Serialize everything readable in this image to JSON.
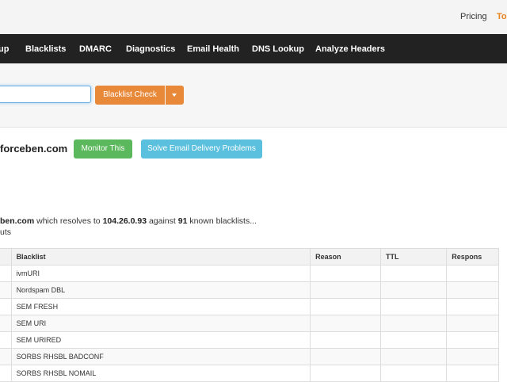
{
  "header": {
    "pricing": "Pricing",
    "tools": "To"
  },
  "nav": [
    "up",
    "Blacklists",
    "DMARC",
    "Diagnostics",
    "Email Health",
    "DNS Lookup",
    "Analyze Headers"
  ],
  "search": {
    "value": "",
    "button": "Blacklist Check"
  },
  "result": {
    "domain": "forceben.com",
    "monitor_button": "Monitor This",
    "solve_button": "Solve Email Delivery Problems",
    "resolve_prefix": "ben.com",
    "resolve_mid1": " which resolves to ",
    "ip": "104.26.0.93",
    "resolve_mid2": " against ",
    "count": "91",
    "resolve_suffix": " known blacklists...",
    "timeouts": "uts"
  },
  "table": {
    "headers": [
      "",
      "Blacklist",
      "Reason",
      "TTL",
      "Respons"
    ],
    "rows": [
      [
        "",
        "ivmURI",
        "",
        "",
        ""
      ],
      [
        "",
        "Nordspam DBL",
        "",
        "",
        ""
      ],
      [
        "",
        "SEM FRESH",
        "",
        "",
        ""
      ],
      [
        "",
        "SEM URI",
        "",
        "",
        ""
      ],
      [
        "",
        "SEM URIRED",
        "",
        "",
        ""
      ],
      [
        "",
        "SORBS RHSBL BADCONF",
        "",
        "",
        ""
      ],
      [
        "",
        "SORBS RHSBL NOMAIL",
        "",
        "",
        ""
      ]
    ]
  },
  "colors": {
    "accent_orange": "#e8893a",
    "green": "#5cb85c",
    "blue": "#5bc0de",
    "navbar": "#222222"
  }
}
